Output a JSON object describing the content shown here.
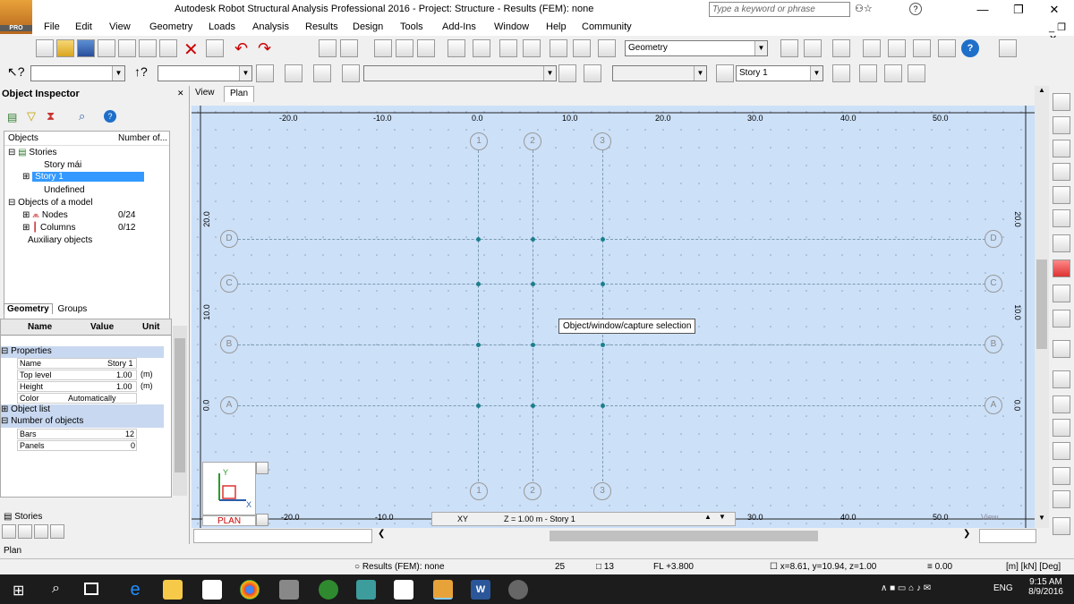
{
  "app": {
    "title": "Autodesk Robot Structural Analysis Professional 2016 - Project: Structure - Results (FEM): none",
    "logo_label": "PRO",
    "search_placeholder": "Type a keyword or phrase"
  },
  "menu": [
    "File",
    "Edit",
    "View",
    "Geometry",
    "Loads",
    "Analysis",
    "Results",
    "Design",
    "Tools",
    "Add-Ins",
    "Window",
    "Help",
    "Community"
  ],
  "toolbar": {
    "layout_combo": "Geometry",
    "story_combo": "Story 1"
  },
  "inspector": {
    "title": "Object Inspector",
    "col_objects": "Objects",
    "col_number": "Number of...",
    "tree": [
      {
        "label": "Stories",
        "value": ""
      },
      {
        "label": "Story mái",
        "value": ""
      },
      {
        "label": "Story 1",
        "value": ""
      },
      {
        "label": "Undefined",
        "value": ""
      },
      {
        "label": "Objects of a model",
        "value": ""
      },
      {
        "label": "Nodes",
        "value": "0/24"
      },
      {
        "label": "Columns",
        "value": "0/12"
      },
      {
        "label": "Auxiliary objects",
        "value": ""
      }
    ],
    "tabs": [
      "Geometry",
      "Groups"
    ],
    "props_header": {
      "name": "Name",
      "value": "Value",
      "unit": "Unit"
    },
    "props": [
      {
        "name": "Properties",
        "value": "",
        "unit": ""
      },
      {
        "name": "Name",
        "value": "Story 1",
        "unit": ""
      },
      {
        "name": "Top level",
        "value": "1.00",
        "unit": "(m)"
      },
      {
        "name": "Height",
        "value": "1.00",
        "unit": "(m)"
      },
      {
        "name": "Color",
        "value": "Automatically",
        "unit": ""
      },
      {
        "name": "Object list",
        "value": "",
        "unit": ""
      },
      {
        "name": "Number of objects",
        "value": "",
        "unit": ""
      },
      {
        "name": "Bars",
        "value": "12",
        "unit": ""
      },
      {
        "name": "Panels",
        "value": "0",
        "unit": ""
      }
    ],
    "bottom_tab": "Stories"
  },
  "view": {
    "tabs": [
      "View",
      "Plan"
    ],
    "x_ticks": [
      "-20.0",
      "-10.0",
      "0.0",
      "10.0",
      "20.0",
      "30.0",
      "40.0",
      "50.0"
    ],
    "y_ticks": [
      "20.0",
      "10.0",
      "0.0"
    ],
    "column_bubbles": [
      "1",
      "2",
      "3"
    ],
    "row_bubbles": [
      "D",
      "C",
      "B",
      "A"
    ],
    "tooltip": "Object/window/capture selection",
    "plan_label": "PLAN",
    "xy_label": "XY",
    "z_label": "Z = 1.00 m - Story 1",
    "view_label": "View"
  },
  "panel_label": "Plan",
  "status": {
    "results": "Results (FEM): none",
    "num1": "25",
    "num2": "13",
    "fl": "FL +3.800",
    "coords": "x=8.61, y=10.94, z=1.00",
    "value": "0.00",
    "units": "[m] [kN] [Deg]"
  },
  "taskbar": {
    "lang": "ENG",
    "time": "9:15 AM",
    "date": "8/9/2016"
  }
}
